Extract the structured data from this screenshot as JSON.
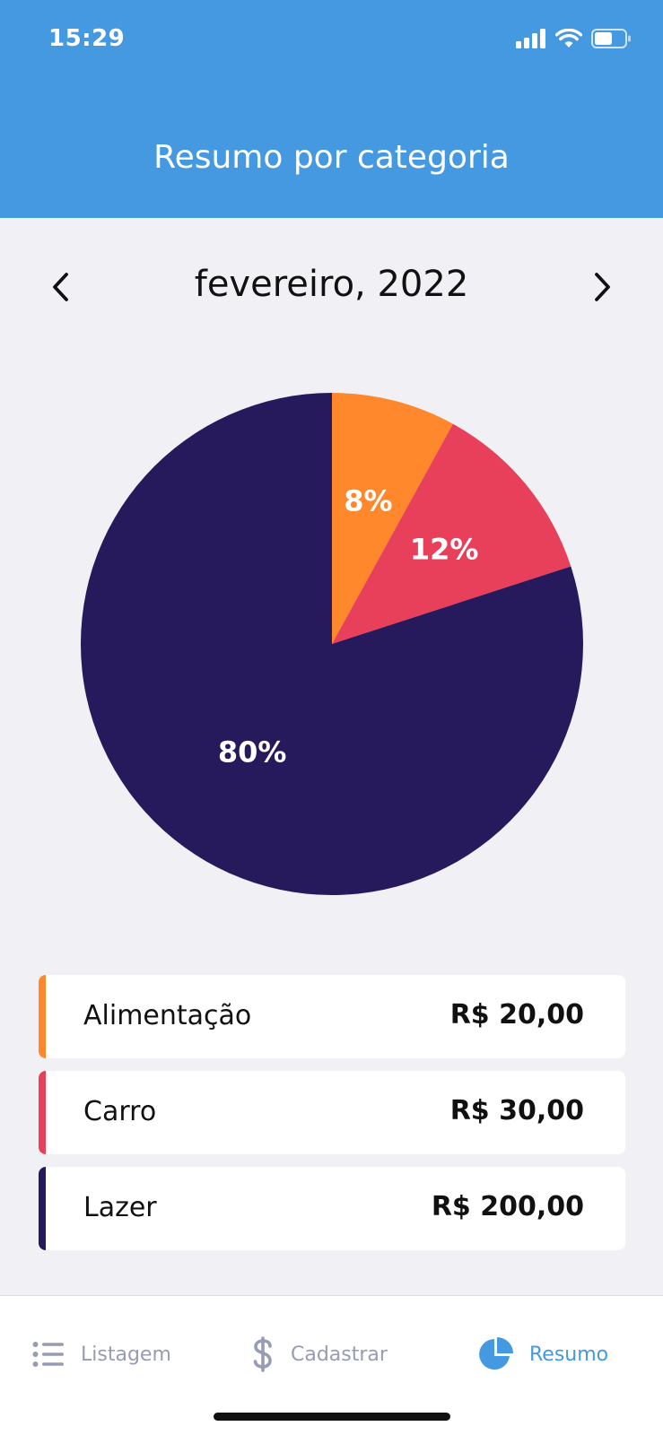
{
  "status_bar": {
    "time": "15:29"
  },
  "header": {
    "title": "Resumo por categoria"
  },
  "month_nav": {
    "month": "fevereiro, 2022"
  },
  "chart_data": {
    "type": "pie",
    "slices": [
      {
        "label": "Alimentação",
        "percent": 8,
        "text": "8%",
        "color": "#ff872c"
      },
      {
        "label": "Carro",
        "percent": 12,
        "text": "12%",
        "color": "#e83f5b"
      },
      {
        "label": "Lazer",
        "percent": 80,
        "text": "80%",
        "color": "#26195c"
      }
    ]
  },
  "categories": [
    {
      "name": "Alimentação",
      "amount": "R$ 20,00",
      "color": "#ff872c"
    },
    {
      "name": "Carro",
      "amount": "R$ 30,00",
      "color": "#e83f5b"
    },
    {
      "name": "Lazer",
      "amount": "R$ 200,00",
      "color": "#26195c"
    }
  ],
  "tabs": [
    {
      "label": "Listagem",
      "icon": "list-icon",
      "active": false
    },
    {
      "label": "Cadastrar",
      "icon": "dollar-icon",
      "active": false
    },
    {
      "label": "Resumo",
      "icon": "pie-chart-icon",
      "active": true
    }
  ],
  "colors": {
    "primary": "#4499e1",
    "background": "#f0f0f5",
    "inactive_tab": "#969cb3"
  }
}
